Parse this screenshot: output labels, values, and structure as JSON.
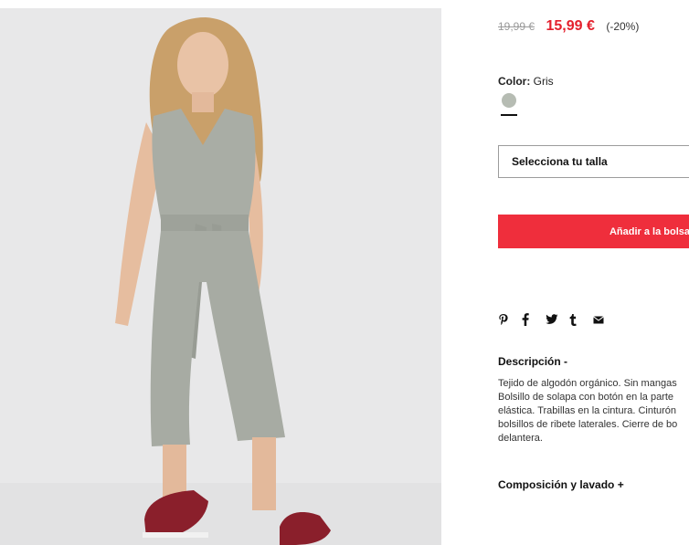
{
  "product": {
    "image_alt": "girl wearing grey sleeveless jumpsuit and red sneakers",
    "old_price": "19,99 €",
    "sale_price": "15,99 €",
    "discount": "(-20%)",
    "color_label": "Color:",
    "color_value": "Gris",
    "swatch_color": "#b6bcb3",
    "size_placeholder": "Selecciona tu talla",
    "add_to_bag": "Añadir a la bolsa",
    "accent_color": "#ef2e3c"
  },
  "share": {
    "icons": [
      "pinterest-icon",
      "facebook-icon",
      "twitter-icon",
      "tumblr-icon",
      "mail-icon"
    ]
  },
  "description": {
    "title": "Descripción -",
    "lines": [
      "Tejido de algodón orgánico. Sin mangas",
      "Bolsillo de solapa con botón en la parte",
      "elástica. Trabillas en la cintura. Cinturón",
      "bolsillos de ribete laterales. Cierre de bo",
      "delantera."
    ]
  },
  "composition": {
    "title": "Composición y lavado +"
  }
}
